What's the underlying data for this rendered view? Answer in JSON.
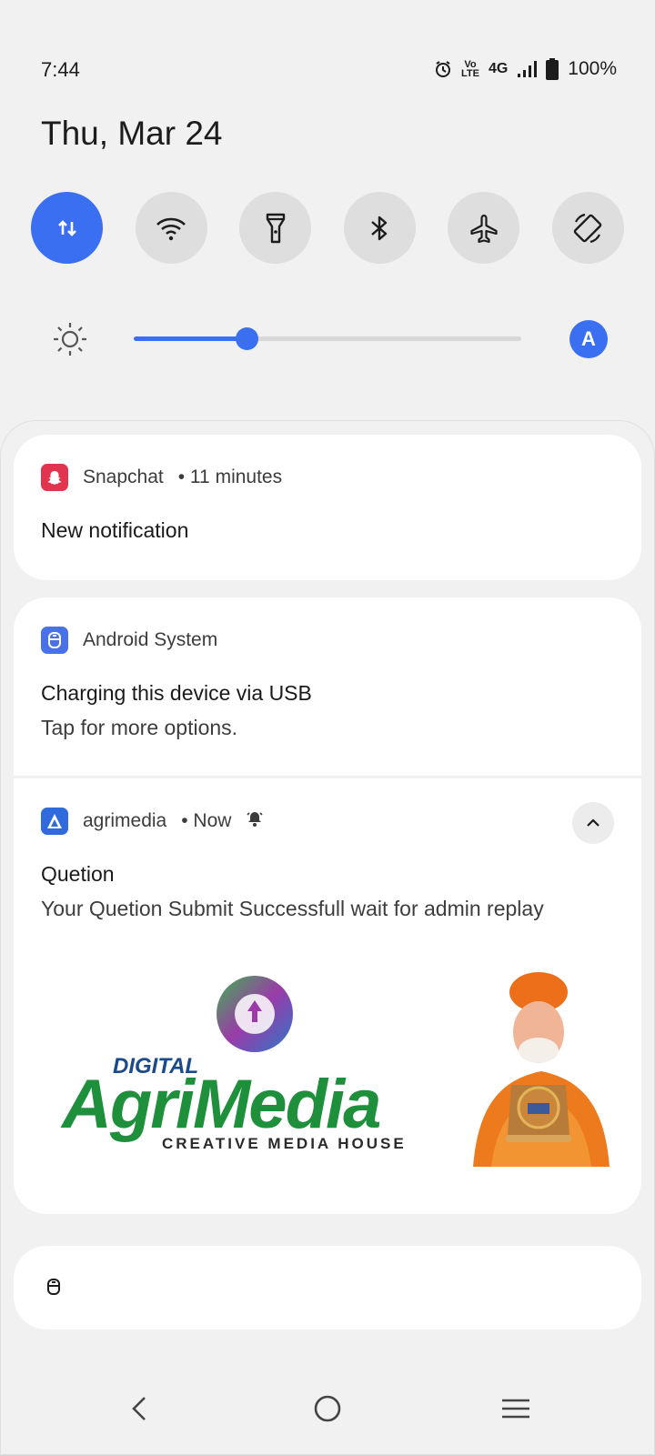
{
  "status": {
    "time": "7:44",
    "network": "4G",
    "battery": "100%",
    "icons": [
      "alarm-icon",
      "volte-icon",
      "signal-icon",
      "battery-icon"
    ]
  },
  "date": "Thu, Mar 24",
  "quick_settings": [
    {
      "name": "mobile-data",
      "icon": "data-arrows-icon",
      "active": true
    },
    {
      "name": "wifi",
      "icon": "wifi-icon",
      "active": false
    },
    {
      "name": "flashlight",
      "icon": "flashlight-icon",
      "active": false
    },
    {
      "name": "bluetooth",
      "icon": "bluetooth-icon",
      "active": false
    },
    {
      "name": "airplane",
      "icon": "airplane-icon",
      "active": false
    },
    {
      "name": "auto-rotate",
      "icon": "rotate-icon",
      "active": false
    }
  ],
  "brightness": {
    "level_fraction": 0.29,
    "auto_label": "A"
  },
  "colors": {
    "accent": "#3b6ff2",
    "snapchat": "#e0344f",
    "system": "#4a72e8"
  },
  "notifications": [
    {
      "app": "Snapchat",
      "meta": "• 11 minutes",
      "title": "New notification",
      "text": ""
    },
    {
      "app": "Android System",
      "meta": "",
      "title": "Charging this device via USB",
      "text": "Tap for more options."
    },
    {
      "app": "agrimedia",
      "meta": "• Now",
      "title": "Quetion",
      "text": "Your Quetion Submit Successfull wait for admin replay",
      "image_logo": {
        "line1": "DIGITAL",
        "line2": "AgriMedia",
        "line3": "CREATIVE MEDIA HOUSE"
      }
    }
  ],
  "nav": {
    "back": "back-icon",
    "home": "home-icon",
    "recents": "menu-icon"
  }
}
